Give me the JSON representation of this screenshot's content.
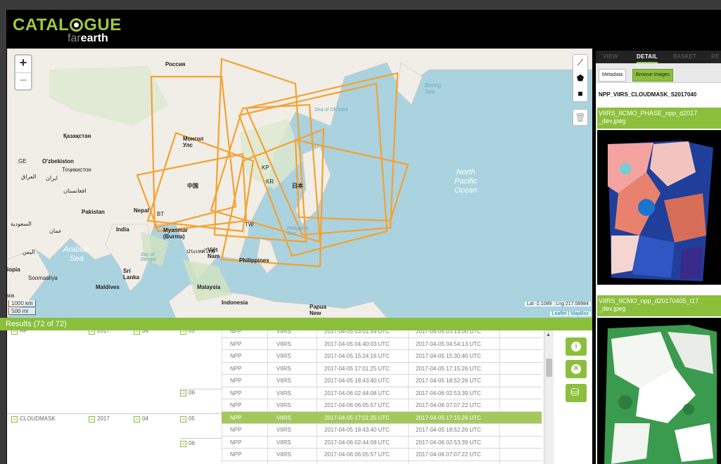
{
  "app": {
    "logo_main_left": "CATAL",
    "logo_main_right": "GUE",
    "logo_sub_light": "far",
    "logo_sub_bold": "earth"
  },
  "map": {
    "labels": {
      "russia": "Россия",
      "kazakhstan": "Қазақстан",
      "mongolia": "Монгол\nУлс",
      "uzbekistan": "O'zbekiston",
      "tajikistan": "Тоҷикистон",
      "china": "中国",
      "japan": "日本",
      "kr": "KR",
      "kp": "KP",
      "tw": "TW",
      "pakistan": "Pakistan",
      "nepal": "Nepal",
      "bt": "BT",
      "india": "India",
      "myanmar": "Myanmar\n(Burma)",
      "vietnam": "Việt\nNam",
      "thailand": "ประเทศไทย",
      "philippines": "Philippines",
      "srilanka": "Sri\nLanka",
      "maldives": "Maldives",
      "malaysia": "Malaysia",
      "indonesia": "Indonesia",
      "papua": "Papua\nNew",
      "iran": "ایران",
      "iraq": "العراق",
      "afghanistan": "افغانستان",
      "saudi": "السعودية",
      "oman": "عمان",
      "yemen": "اليمن",
      "ethiopia": "iopia",
      "somalia": "Soomaaliya",
      "ge": "GE",
      "arabian_sea": "Arabian\nSea",
      "bay_of_bengal": "Bay of\nBengal",
      "north_pacific": "North\nPacific\nOcean",
      "bering_sea": "Bering\nSea",
      "sea_of_okhotsk": "Sea of Okhotsk",
      "philippine_sea": "Philippine\nSea",
      "wa": "wa"
    },
    "zoom_in": "+",
    "zoom_out": "−",
    "scale_km": "1000 km",
    "scale_mi": "500 mi",
    "coords": "Lat -2.1089 : Lng 217.08984",
    "attribution": "Leaflet | MapBox",
    "footprint_color": "#f5a132"
  },
  "results": {
    "header": "Results (72 of 72)",
    "tree": {
      "groups": [
        {
          "product": "AF",
          "year": "2017",
          "month": "04",
          "days": [
            "05",
            "06"
          ]
        },
        {
          "product": "CLOUDMASK",
          "year": "2017",
          "month": "04",
          "days": [
            "05",
            "06"
          ]
        }
      ]
    },
    "rows": [
      {
        "sat": "NPP",
        "sensor": "VIIRS",
        "start": "2017-04-05 03:01:39 UTC",
        "end": "2017-04-05 03:13:00 UTC"
      },
      {
        "sat": "NPP",
        "sensor": "VIIRS",
        "start": "2017-04-05 04:40:03 UTC",
        "end": "2017-04-05 04:54:13 UTC"
      },
      {
        "sat": "NPP",
        "sensor": "VIIRS",
        "start": "2017-04-05 15:24:16 UTC",
        "end": "2017-04-05 15:30:40 UTC"
      },
      {
        "sat": "NPP",
        "sensor": "VIIRS",
        "start": "2017-04-05 17:01:25 UTC",
        "end": "2017-04-05 17:15:26 UTC"
      },
      {
        "sat": "NPP",
        "sensor": "VIIRS",
        "start": "2017-04-05 18:43:40 UTC",
        "end": "2017-04-05 18:52:26 UTC"
      },
      {
        "sat": "NPP",
        "sensor": "VIIRS",
        "start": "2017-04-06 02:44:08 UTC",
        "end": "2017-04-06 02:53:39 UTC"
      },
      {
        "sat": "NPP",
        "sensor": "VIIRS",
        "start": "2017-04-06 06:05:57 UTC",
        "end": "2017-04-06 07:07:22 UTC"
      },
      {
        "sat": "NPP",
        "sensor": "VIIRS",
        "start": "2017-04-05 17:01:25 UTC",
        "end": "2017-04-05 17:15:26 UTC"
      },
      {
        "sat": "NPP",
        "sensor": "VIIRS",
        "start": "2017-04-05 18:43:40 UTC",
        "end": "2017-04-05 18:52:26 UTC"
      },
      {
        "sat": "NPP",
        "sensor": "VIIRS",
        "start": "2017-04-06 02:44:08 UTC",
        "end": "2017-04-06 02:53:39 UTC"
      },
      {
        "sat": "NPP",
        "sensor": "VIIRS",
        "start": "2017-04-06 06:05:57 UTC",
        "end": "2017-04-06 07:07:22 UTC"
      }
    ],
    "selected_row": 7,
    "action_icons": [
      "info-icon",
      "close-icon",
      "basket-icon"
    ],
    "accent_color": "#8bbf3c"
  },
  "panel": {
    "tabs": [
      "VIEW",
      "DETAIL",
      "BASKET",
      "RE"
    ],
    "active_tab": "DETAIL",
    "subtabs": [
      "Metadata",
      "Browse Images"
    ],
    "active_subtab": "Browse Images",
    "product_name": "NPP_VIIRS_CLOUDMASK_S2017040",
    "images": [
      {
        "title": "VIIRS_IICMO_PHASE_npp_d2017\n_dev.jpeg"
      },
      {
        "title": "VIIRS_IICMO_npp_d20170405_t17\n_dev.jpeg"
      }
    ]
  }
}
